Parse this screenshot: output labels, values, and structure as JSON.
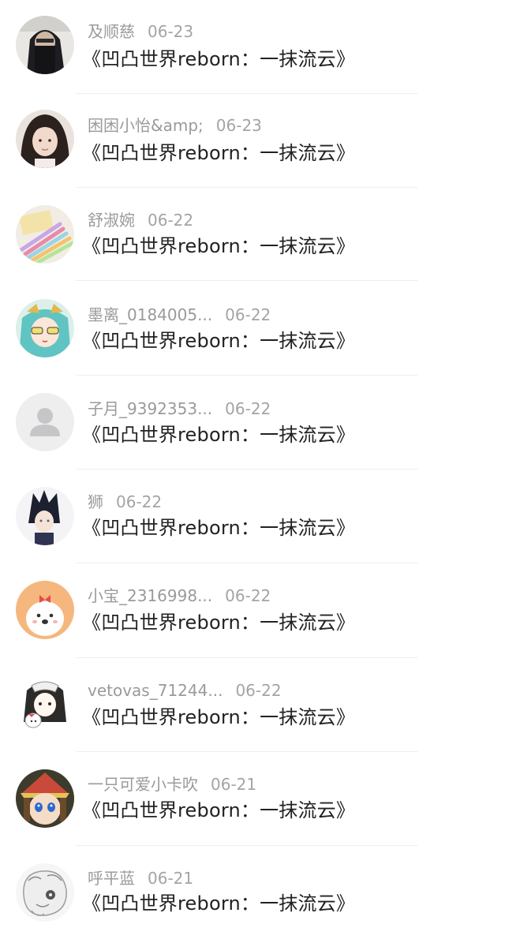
{
  "items": [
    {
      "name": "及顺慈",
      "date": "06-23",
      "title": "《凹凸世界reborn：一抹流云》",
      "avatar": "avatar-girl-black-hood"
    },
    {
      "name": "困困小怡&amp;",
      "date": "06-23",
      "title": "《凹凸世界reborn：一抹流云》",
      "avatar": "avatar-girl-photo"
    },
    {
      "name": "舒淑婉",
      "date": "06-22",
      "title": "《凹凸世界reborn：一抹流云》",
      "avatar": "avatar-colored-pencils"
    },
    {
      "name": "墨离_0184005...",
      "date": "06-22",
      "title": "《凹凸世界reborn：一抹流云》",
      "avatar": "avatar-anime-teal-hair"
    },
    {
      "name": "子月_9392353...",
      "date": "06-22",
      "title": "《凹凸世界reborn：一抹流云》",
      "avatar": "default-user-icon"
    },
    {
      "name": "狮",
      "date": "06-22",
      "title": "《凹凸世界reborn：一抹流云》",
      "avatar": "avatar-anime-dark-hair"
    },
    {
      "name": "小宝_2316998...",
      "date": "06-22",
      "title": "《凹凸世界reborn：一抹流云》",
      "avatar": "avatar-cartoon-dog"
    },
    {
      "name": "vetovas_71244...",
      "date": "06-22",
      "title": "《凹凸世界reborn：一抹流云》",
      "avatar": "avatar-anime-hello-kitty"
    },
    {
      "name": "一只可爱小卡吹",
      "date": "06-21",
      "title": "《凹凸世界reborn：一抹流云》",
      "avatar": "avatar-anime-red-hat"
    },
    {
      "name": "呼平蓝",
      "date": "06-21",
      "title": "《凹凸世界reborn：一抹流云》",
      "avatar": "avatar-sketch-white"
    }
  ]
}
